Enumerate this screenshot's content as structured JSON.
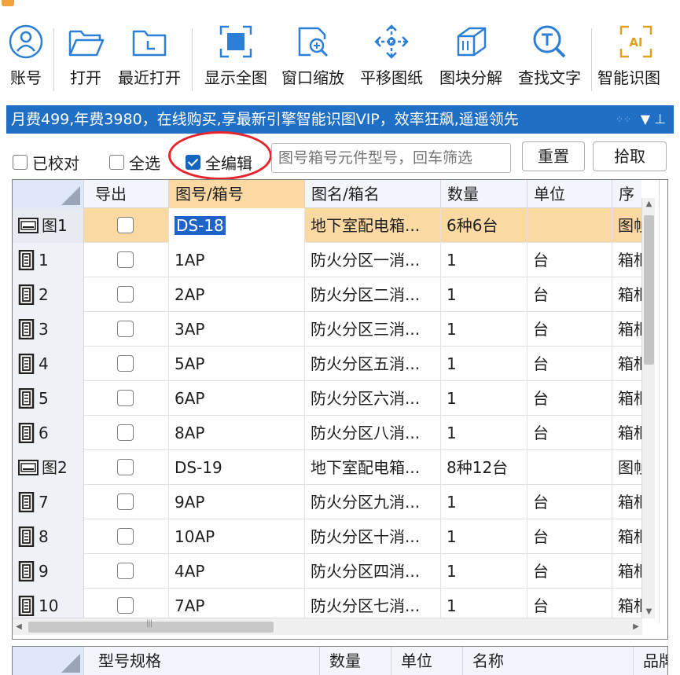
{
  "toolbar": {
    "buttons": [
      {
        "label": "账号",
        "icon": "user-icon"
      },
      {
        "label": "打开",
        "icon": "folder-open-icon"
      },
      {
        "label": "最近打开",
        "icon": "recent-folder-icon"
      },
      {
        "label": "显示全图",
        "icon": "fit-view-icon"
      },
      {
        "label": "窗口缩放",
        "icon": "zoom-window-icon"
      },
      {
        "label": "平移图纸",
        "icon": "pan-icon"
      },
      {
        "label": "图块分解",
        "icon": "explode-block-icon"
      },
      {
        "label": "查找文字",
        "icon": "find-text-icon"
      },
      {
        "label": "智能识图",
        "icon": "ai-recognize-icon"
      }
    ],
    "icon_color": "#2b7fd6"
  },
  "banner": {
    "text": "月费499,年费3980，在线购买,享最新引擎智能识图VIP，效率狂飙,遥遥领先",
    "dropdown": "▼",
    "pin": "⊥",
    "color": "#1f6fc6"
  },
  "filter": {
    "checked_label": "已校对",
    "select_all_label": "全选",
    "edit_all_label": "全编辑",
    "edit_all_checked": true,
    "search_placeholder": "图号箱号元件型号，回车筛选",
    "reset_label": "重置",
    "pick_label": "拾取"
  },
  "table": {
    "columns": [
      "导出",
      "图号/箱号",
      "图名/箱名",
      "数量",
      "单位",
      "序"
    ],
    "rows": [
      {
        "id": "图1",
        "type": "drawing",
        "code": "DS-18",
        "name": "地下室配电箱...",
        "qty": "6种6台",
        "unit": "",
        "tail": "图帧",
        "selected": true
      },
      {
        "id": "1",
        "type": "box",
        "code": "1AP",
        "name": "防火分区一消...",
        "qty": "1",
        "unit": "台",
        "tail": "箱柜"
      },
      {
        "id": "2",
        "type": "box",
        "code": "2AP",
        "name": "防火分区二消...",
        "qty": "1",
        "unit": "台",
        "tail": "箱柜"
      },
      {
        "id": "3",
        "type": "box",
        "code": "3AP",
        "name": "防火分区三消...",
        "qty": "1",
        "unit": "台",
        "tail": "箱柜"
      },
      {
        "id": "4",
        "type": "box",
        "code": "5AP",
        "name": "防火分区五消...",
        "qty": "1",
        "unit": "台",
        "tail": "箱柜"
      },
      {
        "id": "5",
        "type": "box",
        "code": "6AP",
        "name": "防火分区六消...",
        "qty": "1",
        "unit": "台",
        "tail": "箱柜"
      },
      {
        "id": "6",
        "type": "box",
        "code": "8AP",
        "name": "防火分区八消...",
        "qty": "1",
        "unit": "台",
        "tail": "箱柜"
      },
      {
        "id": "图2",
        "type": "drawing",
        "code": "DS-19",
        "name": "地下室配电箱...",
        "qty": "8种12台",
        "unit": "",
        "tail": "图帧"
      },
      {
        "id": "7",
        "type": "box",
        "code": "9AP",
        "name": "防火分区九消...",
        "qty": "1",
        "unit": "台",
        "tail": "箱柜"
      },
      {
        "id": "8",
        "type": "box",
        "code": "10AP",
        "name": "防火分区十消...",
        "qty": "1",
        "unit": "台",
        "tail": "箱柜"
      },
      {
        "id": "9",
        "type": "box",
        "code": "4AP",
        "name": "防火分区四消...",
        "qty": "1",
        "unit": "台",
        "tail": "箱柜"
      },
      {
        "id": "10",
        "type": "box",
        "code": "7AP",
        "name": "防火分区七消...",
        "qty": "1",
        "unit": "台",
        "tail": "箱柜"
      }
    ]
  },
  "bottom_table": {
    "columns": [
      "型号规格",
      "数量",
      "单位",
      "名称",
      "品牌"
    ]
  },
  "scroll": {
    "up": "▲",
    "down": "▼",
    "left": "◀",
    "right": "▶"
  },
  "colors": {
    "accent": "#1565c0",
    "selected_row": "#fbd9a2",
    "highlight_oval": "#e8232a"
  }
}
